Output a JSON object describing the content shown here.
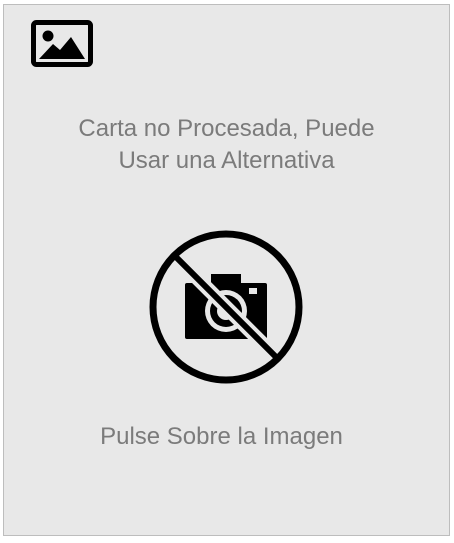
{
  "placeholder": {
    "message_line1": "Carta no Procesada, Puede",
    "message_line2": "Usar una Alternativa",
    "hint": "Pulse Sobre la Imagen",
    "icons": [
      "image-icon",
      "no-camera-icon"
    ],
    "colors": {
      "background": "#e8e8e8",
      "text": "#7b7b7b",
      "icon": "#000000"
    }
  }
}
